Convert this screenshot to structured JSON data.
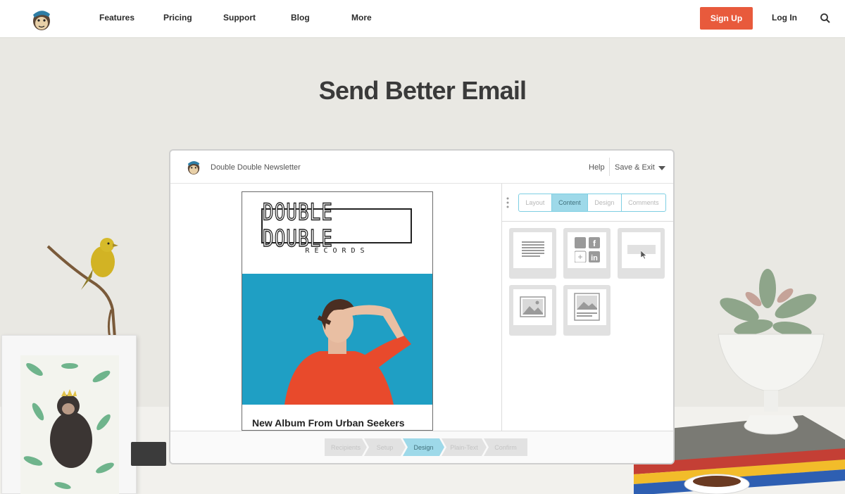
{
  "nav": {
    "links": [
      "Features",
      "Pricing",
      "Support",
      "Blog",
      "More"
    ],
    "signup_label": "Sign Up",
    "login_label": "Log In",
    "search_icon": "search-icon"
  },
  "hero": {
    "title": "Send Better Email"
  },
  "editor": {
    "campaign_title": "Double Double Newsletter",
    "help_label": "Help",
    "save_label": "Save & Exit",
    "tabs": [
      "Layout",
      "Content",
      "Design",
      "Comments"
    ],
    "active_tab": "Content",
    "content_blocks": [
      "text-block-icon",
      "social-share-icon",
      "button-block-icon",
      "image-block-icon",
      "image-card-block-icon"
    ],
    "steps": [
      "Recipients",
      "Setup",
      "Design",
      "Plain-Text",
      "Confirm"
    ],
    "active_step": "Design"
  },
  "email_preview": {
    "brand_name": "DOUBLE DOUBLE",
    "brand_sub": "RECORDS",
    "headline": "New Album From Urban Seekers"
  },
  "colors": {
    "accent": "#e85a3c",
    "active_tab": "#9ed9e9",
    "photo_background": "#1f9fc4",
    "page_background": "#e9e8e3"
  }
}
